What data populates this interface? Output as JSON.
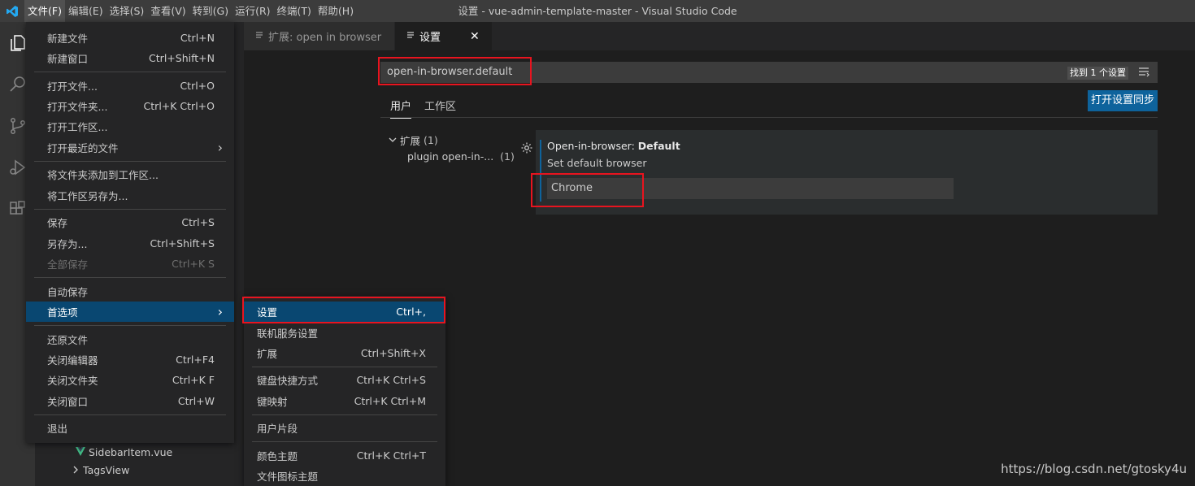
{
  "titlebar": {
    "menus": [
      "文件(F)",
      "编辑(E)",
      "选择(S)",
      "查看(V)",
      "转到(G)",
      "运行(R)",
      "终端(T)",
      "帮助(H)"
    ],
    "title": "设置 - vue-admin-template-master - Visual Studio Code"
  },
  "tabs": [
    {
      "label": "扩展: open in browser",
      "active": false
    },
    {
      "label": "设置",
      "active": true
    }
  ],
  "settings": {
    "search_value": "open-in-browser.default",
    "found_badge": "找到 1 个设置",
    "scope_tabs": [
      "用户",
      "工作区"
    ],
    "sync_button": "打开设置同步",
    "toc": {
      "group_label": "扩展",
      "group_count": "(1)",
      "item_label": "plugin open-in-...",
      "item_count": "(1)"
    },
    "item": {
      "title_prefix": "Open-in-browser: ",
      "title_name": "Default",
      "description": "Set default browser",
      "value": "Chrome"
    }
  },
  "explorer": {
    "rows": [
      "SidebarItem.vue",
      "TagsView"
    ]
  },
  "file_menu": {
    "items": [
      {
        "label": "新建文件",
        "shortcut": "Ctrl+N"
      },
      {
        "label": "新建窗口",
        "shortcut": "Ctrl+Shift+N"
      },
      {
        "label": "打开文件...",
        "shortcut": "Ctrl+O"
      },
      {
        "label": "打开文件夹...",
        "shortcut": "Ctrl+K Ctrl+O"
      },
      {
        "label": "打开工作区...",
        "shortcut": ""
      },
      {
        "label": "打开最近的文件",
        "shortcut": "›"
      },
      {
        "label": "将文件夹添加到工作区...",
        "shortcut": ""
      },
      {
        "label": "将工作区另存为...",
        "shortcut": ""
      },
      {
        "label": "保存",
        "shortcut": "Ctrl+S"
      },
      {
        "label": "另存为...",
        "shortcut": "Ctrl+Shift+S"
      },
      {
        "label": "全部保存",
        "shortcut": "Ctrl+K S"
      },
      {
        "label": "自动保存",
        "shortcut": ""
      },
      {
        "label": "首选项",
        "shortcut": "›"
      },
      {
        "label": "还原文件",
        "shortcut": ""
      },
      {
        "label": "关闭编辑器",
        "shortcut": "Ctrl+F4"
      },
      {
        "label": "关闭文件夹",
        "shortcut": "Ctrl+K F"
      },
      {
        "label": "关闭窗口",
        "shortcut": "Ctrl+W"
      },
      {
        "label": "退出",
        "shortcut": ""
      }
    ]
  },
  "prefs_menu": {
    "items": [
      {
        "label": "设置",
        "shortcut": "Ctrl+,"
      },
      {
        "label": "联机服务设置",
        "shortcut": ""
      },
      {
        "label": "扩展",
        "shortcut": "Ctrl+Shift+X"
      },
      {
        "label": "键盘快捷方式",
        "shortcut": "Ctrl+K Ctrl+S"
      },
      {
        "label": "键映射",
        "shortcut": "Ctrl+K Ctrl+M"
      },
      {
        "label": "用户片段",
        "shortcut": ""
      },
      {
        "label": "颜色主题",
        "shortcut": "Ctrl+K Ctrl+T"
      },
      {
        "label": "文件图标主题",
        "shortcut": ""
      }
    ]
  },
  "watermark": "https://blog.csdn.net/gtosky4u",
  "colors": {
    "accent": "#0e639c",
    "selection": "#094771",
    "highlight": "#e8141f",
    "vue_green": "#41b883"
  }
}
